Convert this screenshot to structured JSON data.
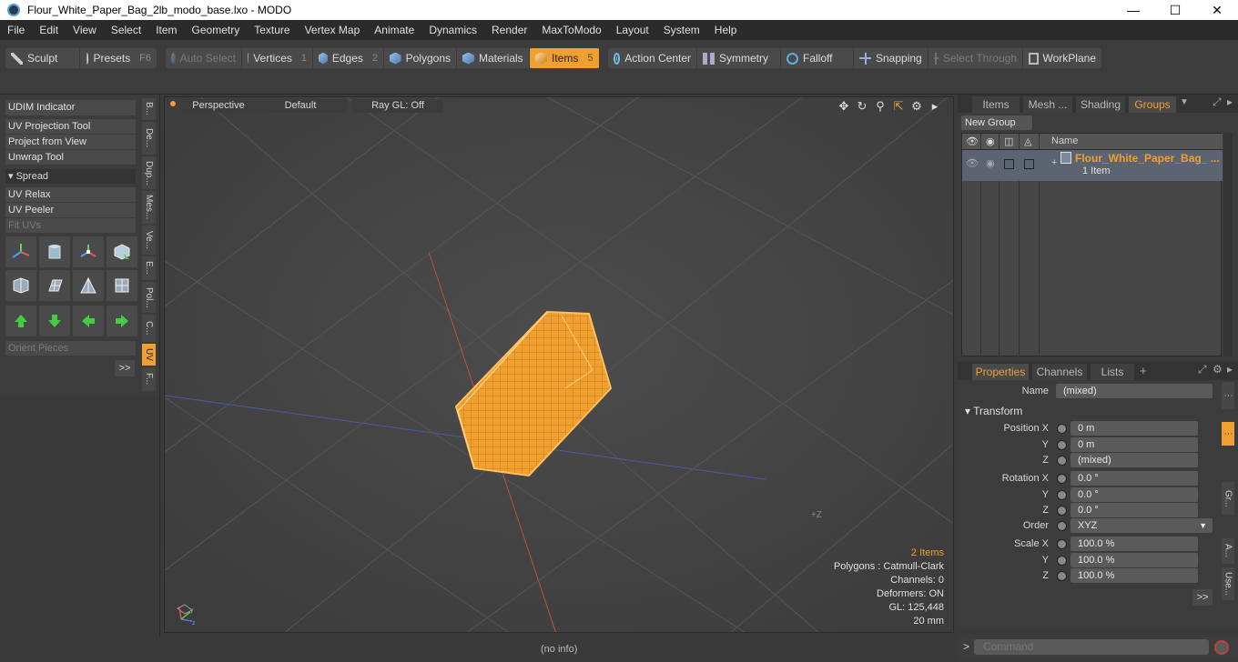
{
  "window": {
    "title": "Flour_White_Paper_Bag_2lb_modo_base.lxo - MODO"
  },
  "menu": [
    "File",
    "Edit",
    "View",
    "Select",
    "Item",
    "Geometry",
    "Texture",
    "Vertex Map",
    "Animate",
    "Dynamics",
    "Render",
    "MaxToModo",
    "Layout",
    "System",
    "Help"
  ],
  "toolbar": {
    "sculpt": "Sculpt",
    "presets": "Presets",
    "presets_key": "F6",
    "auto_select": "Auto Select",
    "vertices": "Vertices",
    "vertices_key": "1",
    "edges": "Edges",
    "edges_key": "2",
    "polygons": "Polygons",
    "materials": "Materials",
    "items": "Items",
    "items_key": "5",
    "action_center": "Action Center",
    "symmetry": "Symmetry",
    "falloff": "Falloff",
    "snapping": "Snapping",
    "select_through": "Select Through",
    "workplane": "WorkPlane"
  },
  "left_panel": {
    "udim": "UDIM Indicator",
    "uv_projection": "UV Projection Tool",
    "project_from_view": "Project from View",
    "unwrap": "Unwrap Tool",
    "spread": "Spread",
    "uv_relax": "UV Relax",
    "uv_peeler": "UV Peeler",
    "fit_uvs": "Fit UVs",
    "orient_pieces": "Orient Pieces",
    "more": ">>",
    "vtabs": [
      "B...",
      "De...",
      "Dup...",
      "Mes...",
      "Ve...",
      "E...",
      "Pol...",
      "C...",
      "UV",
      "F..."
    ]
  },
  "viewport": {
    "perspective": "Perspective",
    "default": "Default",
    "raygl": "Ray GL: Off",
    "stats": {
      "items": "2 Items",
      "polygons": "Polygons : Catmull-Clark",
      "channels": "Channels: 0",
      "deformers": "Deformers: ON",
      "gl": "GL: 125,448",
      "scale": "20 mm"
    },
    "status": "(no info)"
  },
  "groups_panel": {
    "tabs": [
      "Items",
      "Mesh ...",
      "Shading",
      "Groups"
    ],
    "new_group": "New Group",
    "col_name": "Name",
    "row_name": "Flour_White_Paper_Bag_ ...",
    "row_count": "1 Item"
  },
  "properties_panel": {
    "tabs": [
      "Properties",
      "Channels",
      "Lists"
    ],
    "add_tab": "+",
    "name_label": "Name",
    "name_value": "(mixed)",
    "transform": "Transform",
    "position_x_label": "Position X",
    "y_label": "Y",
    "z_label": "Z",
    "pos_x": "0 m",
    "pos_y": "0 m",
    "pos_z": "(mixed)",
    "rotation_x_label": "Rotation X",
    "rot_x": "0.0 °",
    "rot_y": "0.0 °",
    "rot_z": "0.0 °",
    "order_label": "Order",
    "order_value": "XYZ",
    "scale_x_label": "Scale X",
    "scale_x": "100.0 %",
    "scale_y": "100.0 %",
    "scale_z": "100.0 %",
    "more": ">>",
    "vtabs": [
      "Gr...",
      "A...",
      "Use..."
    ]
  },
  "command": {
    "placeholder": "Command",
    "prompt": ">"
  },
  "colors": {
    "accent": "#f0a030",
    "bg": "#3c3c3c",
    "viewport": "#454545"
  }
}
